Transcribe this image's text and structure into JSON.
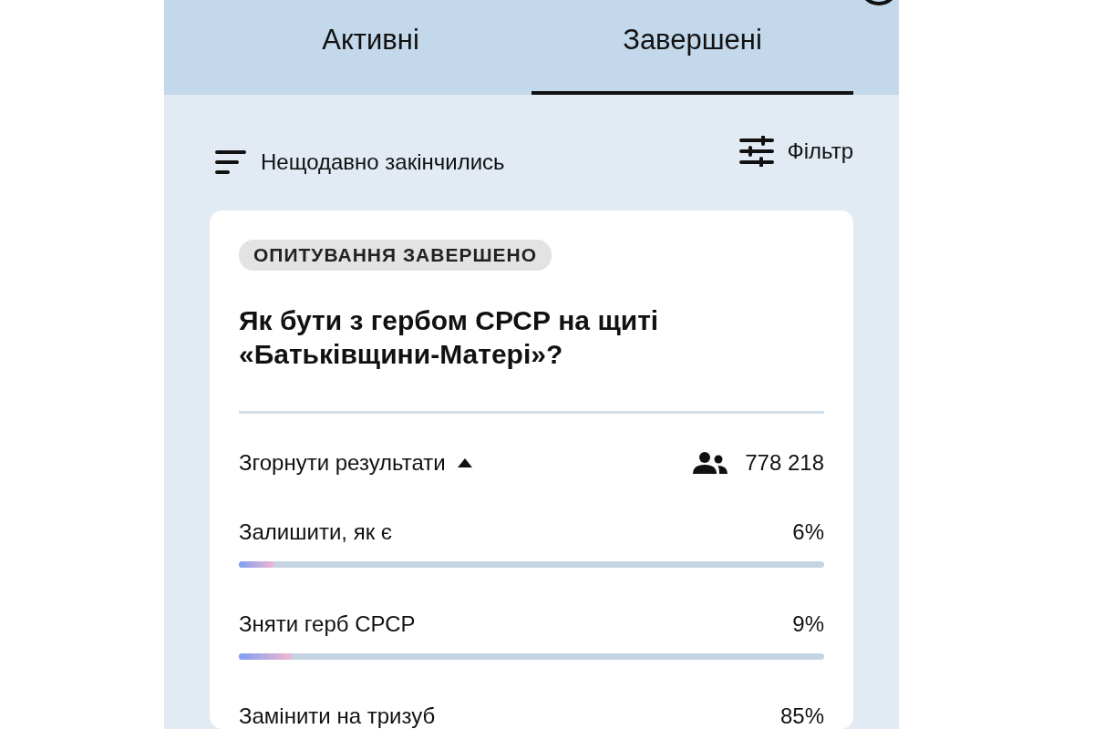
{
  "tabs": [
    {
      "label": "Активні",
      "selected": false
    },
    {
      "label": "Завершені",
      "selected": true
    }
  ],
  "toolbar": {
    "sort": "Нещодавно закінчились",
    "filter": "Фільтр"
  },
  "poll": {
    "status": "ОПИТУВАННЯ ЗАВЕРШЕНО",
    "question": "Як бути з гербом СРСР на щиті «Батьківщини-Матері»?",
    "toggle": "Згорнути результати",
    "expanded": true,
    "votes": "778 218",
    "options": [
      {
        "label": "Залишити, як є",
        "percent": "6%",
        "level": 0.06
      },
      {
        "label": "Зняти герб СРСР",
        "percent": "9%",
        "level": 0.09
      },
      {
        "label": "Замінити на тризуб",
        "percent": "85%"
      }
    ]
  }
}
